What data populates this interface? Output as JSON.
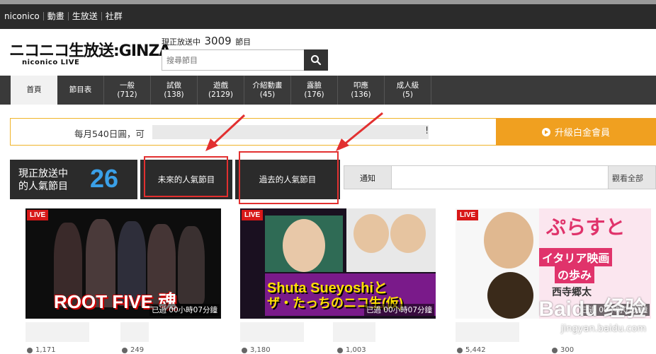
{
  "topnav": {
    "brand": "niconico",
    "items": [
      "動畫",
      "生放送",
      "社群"
    ]
  },
  "header": {
    "logo_main": "ニコニコ生放送:GINZA",
    "logo_sub": "niconico LIVE",
    "live_prefix": "現正放送中",
    "live_count": "3009",
    "live_suffix": "節目",
    "search_placeholder": "搜尋節目"
  },
  "categories": [
    {
      "label": "首頁",
      "count": ""
    },
    {
      "label": "節目表",
      "count": ""
    },
    {
      "label": "一般",
      "count": "(712)"
    },
    {
      "label": "試做",
      "count": "(138)"
    },
    {
      "label": "遊戲",
      "count": "(2129)"
    },
    {
      "label": "介紹動畫",
      "count": "(45)"
    },
    {
      "label": "露臉",
      "count": "(176)"
    },
    {
      "label": "叩應",
      "count": "(136)"
    },
    {
      "label": "成人級",
      "count": "(5)"
    }
  ],
  "banner": {
    "text": "每月540日圓，可",
    "tail": "!",
    "upgrade": "升級白金會員"
  },
  "popular": {
    "label_line1": "現正放送中",
    "label_line2": "的人氣節目",
    "count": "26"
  },
  "tabs": {
    "future": "未來的人氣節目",
    "past": "過去的人氣節目"
  },
  "notice": {
    "label": "通知",
    "view_all": "觀看全部"
  },
  "cards": [
    {
      "badge": "LIVE",
      "overlay": "ROOT FIVE 魂",
      "elapsed": "已過 00小時07分鐘",
      "viewers": "1,171",
      "comments": "249"
    },
    {
      "badge": "LIVE",
      "overlay_line1": "Shuta Sueyoshiと",
      "overlay_line2": "ザ・たっちのニコ生(仮)",
      "elapsed": "已過 00小時07分鐘",
      "viewers": "3,180",
      "comments": "1,003"
    },
    {
      "badge": "LIVE",
      "overlay_title": "ぷらすと",
      "overlay_line1": "イタリア映画",
      "overlay_line2": "の歩み",
      "overlay_line3": "西寺郷太",
      "elapsed": "已過 00小時07分鐘",
      "viewers": "5,442",
      "comments": "300"
    }
  ],
  "watermark": {
    "brand": "Baidu 经验",
    "url": "jingyan.baidu.com"
  },
  "colors": {
    "accent_blue": "#3aa0e8",
    "upgrade_orange": "#f0a020",
    "live_red": "#d81818",
    "annotation_red": "#e23030"
  }
}
